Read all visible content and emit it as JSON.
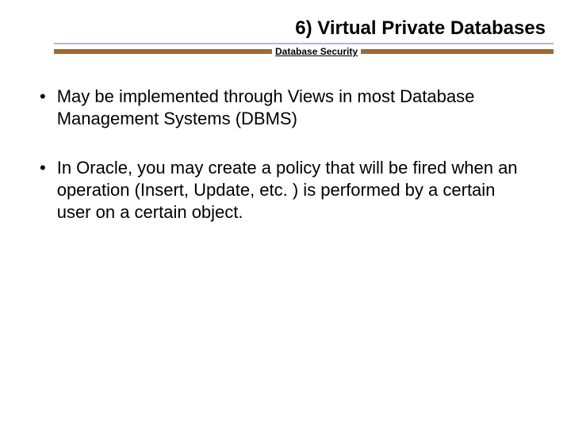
{
  "header": {
    "title": "6) Virtual Private Databases",
    "subtitle": "Database Security"
  },
  "bullets": [
    {
      "text": "May be implemented through Views in most Database Management Systems (DBMS)"
    },
    {
      "text": "In Oracle, you may create a policy that will be fired when an operation (Insert, Update, etc. ) is performed by a certain user on a certain object."
    }
  ]
}
